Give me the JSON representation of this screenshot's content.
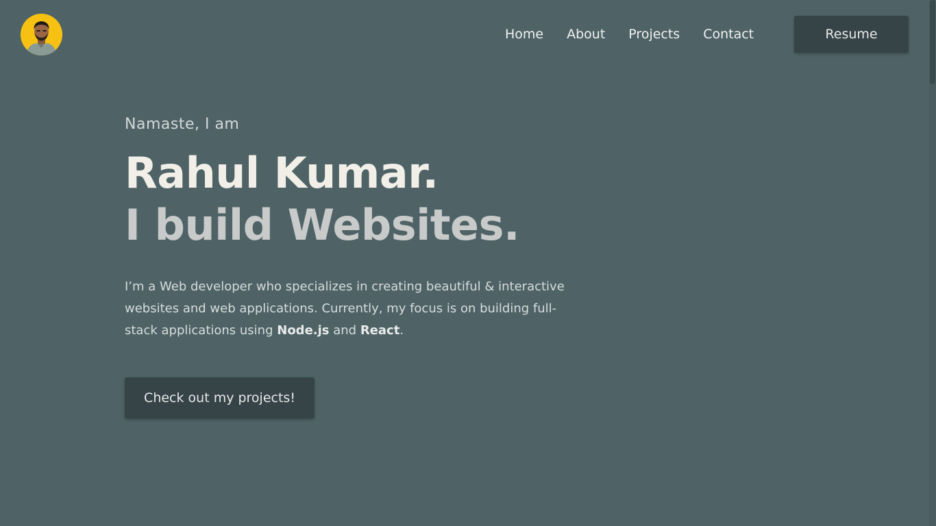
{
  "header": {
    "avatar_icon": "person-avatar-icon",
    "nav": {
      "home": "Home",
      "about": "About",
      "projects": "Projects",
      "contact": "Contact"
    },
    "resume_label": "Resume"
  },
  "hero": {
    "greeting": "Namaste, I am",
    "name": "Rahul Kumar.",
    "tagline": "I build Websites.",
    "intro_part1": "I’m a Web developer who specializes in creating beautiful & interactive websites and web applications. Currently, my focus is on building full-stack applications using ",
    "tech1": "Node.js",
    "intro_and": " and ",
    "tech2": "React",
    "intro_end": ".",
    "cta_label": "Check out my projects!"
  },
  "colors": {
    "background": "#4f6366",
    "button": "#364448",
    "avatar_bg": "#f6c112"
  }
}
